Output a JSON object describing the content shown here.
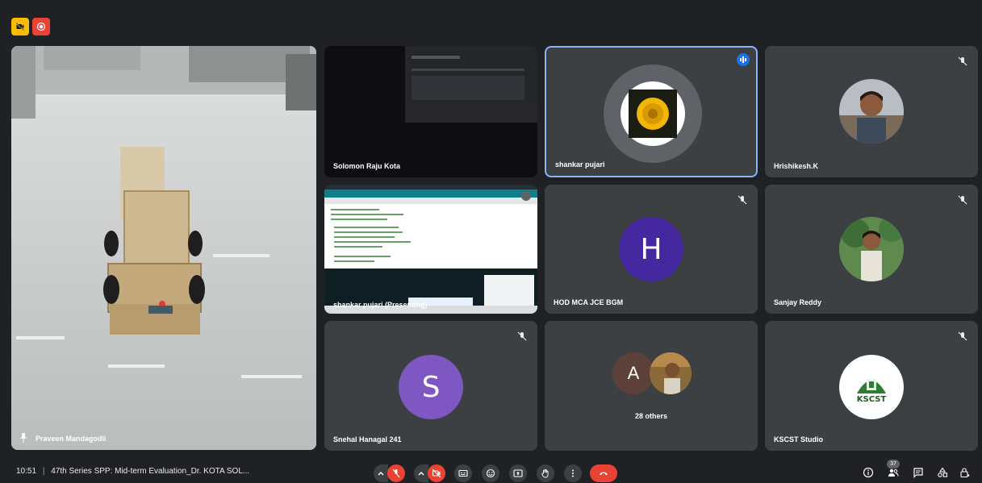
{
  "window": {
    "indicators": [
      {
        "name": "camera-off-indicator",
        "icon": "camera-off-icon",
        "color": "#fbbc04"
      },
      {
        "name": "recording-indicator",
        "icon": "record-icon",
        "color": "#ea4335"
      }
    ]
  },
  "participants": [
    {
      "name": "Praveen Mandagodli",
      "pinned": true,
      "video": "robot-car-video"
    },
    {
      "name": "Solomon Raju Kota",
      "video": "dark-video"
    },
    {
      "name": "shankar pujari",
      "speaking": true,
      "avatar": "flower-photo"
    },
    {
      "name": "Hrishikesh.K",
      "muted": true,
      "avatar": "person-photo"
    },
    {
      "name": "shankar pujari (Presenting)",
      "video": "screen-share"
    },
    {
      "name": "HOD MCA JCE BGM",
      "muted": true,
      "avatar_letter": "H",
      "avatar_color": "#4527a0"
    },
    {
      "name": "Sanjay Reddy",
      "muted": true,
      "avatar": "person-photo"
    },
    {
      "name": "Snehal Hanagal 241",
      "muted": true,
      "avatar_letter": "S",
      "avatar_color": "#7e57c2"
    },
    {
      "others_label": "28 others",
      "avatar_letter": "A",
      "avatar_color": "#5d4037"
    },
    {
      "name": "KSCST Studio",
      "muted": true,
      "avatar_logo_text": "KSCST"
    }
  ],
  "bottombar": {
    "time": "10:51",
    "separator": "|",
    "meeting_title": "47th Series SPP: Mid-term Evaluation_Dr. KOTA SOL...",
    "participant_count": "37"
  },
  "colors": {
    "background": "#202124",
    "tile": "#3c4043",
    "accent_blue": "#8ab4f8",
    "danger": "#ea4335"
  }
}
